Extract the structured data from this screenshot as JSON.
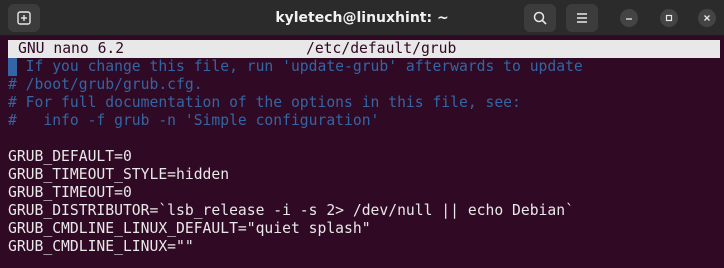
{
  "window": {
    "title": "kyletech@linuxhint: ~"
  },
  "icons": {
    "new_tab": "new-tab-icon",
    "search": "search-icon",
    "menu": "menu-icon",
    "minimize": "minimize-icon",
    "maximize": "maximize-icon",
    "close": "close-icon"
  },
  "colors": {
    "terminal_bg": "#300a24",
    "comment": "#3465a4",
    "text": "#e8e8e8",
    "titlebar": "#2b2b2b"
  },
  "nano": {
    "version": "GNU nano 6.2",
    "filename": "/etc/default/grub"
  },
  "lines": [
    {
      "text": "# If you change this file, run 'update-grub' afterwards to update",
      "kind": "comment"
    },
    {
      "text": "# /boot/grub/grub.cfg.",
      "kind": "comment"
    },
    {
      "text": "# For full documentation of the options in this file, see:",
      "kind": "comment"
    },
    {
      "text": "#   info -f grub -n 'Simple configuration'",
      "kind": "comment"
    },
    {
      "text": "",
      "kind": "blank"
    },
    {
      "text": "GRUB_DEFAULT=0",
      "kind": "code"
    },
    {
      "text": "GRUB_TIMEOUT_STYLE=hidden",
      "kind": "code"
    },
    {
      "text": "GRUB_TIMEOUT=0",
      "kind": "code"
    },
    {
      "text": "GRUB_DISTRIBUTOR=`lsb_release -i -s 2> /dev/null || echo Debian`",
      "kind": "code"
    },
    {
      "text": "GRUB_CMDLINE_LINUX_DEFAULT=\"quiet splash\"",
      "kind": "code"
    },
    {
      "text": "GRUB_CMDLINE_LINUX=\"\"",
      "kind": "code"
    }
  ]
}
